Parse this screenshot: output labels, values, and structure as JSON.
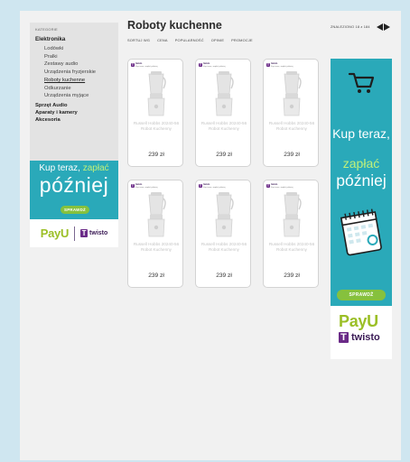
{
  "sidebar": {
    "title": "KATEGORIE",
    "main_category": "Elektronika",
    "sub_items": [
      "Lodówki",
      "Pralki",
      "Zestawy audio",
      "Urządzenia fryzjerskie",
      "Roboty kuchenne",
      "Odkurzanie",
      "Urządzenia myjące"
    ],
    "top_items": [
      "Sprzęt Audio",
      "Aparaty i kamery",
      "Akcesoria"
    ]
  },
  "ad_small": {
    "line1_a": "Kup teraz,",
    "line1_b": "zapłać",
    "line2": "później",
    "button": "SPRAWDŹ",
    "payu": "PayU",
    "twisto": "twisto",
    "twisto_mark": "T"
  },
  "header": {
    "title": "Roboty kuchenne",
    "found": "ZNALEZIONO 18 z 184"
  },
  "sort": {
    "label": "SORTUJ WG",
    "options": [
      "CENA",
      "POPULARNOŚĆ",
      "OPINIE",
      "PROMOCJE"
    ]
  },
  "products": [
    {
      "name": "Russell Hobbs 20240-56 Robot Kuchenny",
      "price": "239 zł",
      "badge_brand": "twisto",
      "badge_text": "Kup teraz, zapłać później"
    },
    {
      "name": "Russell Hobbs 20240-56 Robot Kuchenny",
      "price": "239 zł",
      "badge_brand": "twisto",
      "badge_text": "Kup teraz, zapłać później"
    },
    {
      "name": "Russell Hobbs 20240-56 Robot Kuchenny",
      "price": "239 zł",
      "badge_brand": "twisto",
      "badge_text": "Kup teraz, zapłać później"
    },
    {
      "name": "Russell Hobbs 20240-56 Robot Kuchenny",
      "price": "239 zł",
      "badge_brand": "twisto",
      "badge_text": "Kup teraz, zapłać później"
    },
    {
      "name": "Russell Hobbs 20240-56 Robot Kuchenny",
      "price": "239 zł",
      "badge_brand": "twisto",
      "badge_text": "Kup teraz, zapłać później"
    },
    {
      "name": "Russell Hobbs 20240-56 Robot Kuchenny",
      "price": "239 zł",
      "badge_brand": "twisto",
      "badge_text": "Kup teraz, zapłać później"
    }
  ],
  "ad_big": {
    "line1": "Kup teraz,",
    "line2": "zapłać",
    "line3": "później",
    "button": "SPRAWDŹ",
    "payu": "PayU",
    "twisto": "twisto",
    "twisto_mark": "T"
  },
  "colors": {
    "accent_teal": "#2aa9b9",
    "accent_green": "#86c13d",
    "twisto_purple": "#6a2a87",
    "payu_green": "#9bbf26"
  },
  "icons": [
    "cart-icon",
    "calendar-icon",
    "arrow-left-icon",
    "arrow-right-icon",
    "blender-icon"
  ]
}
